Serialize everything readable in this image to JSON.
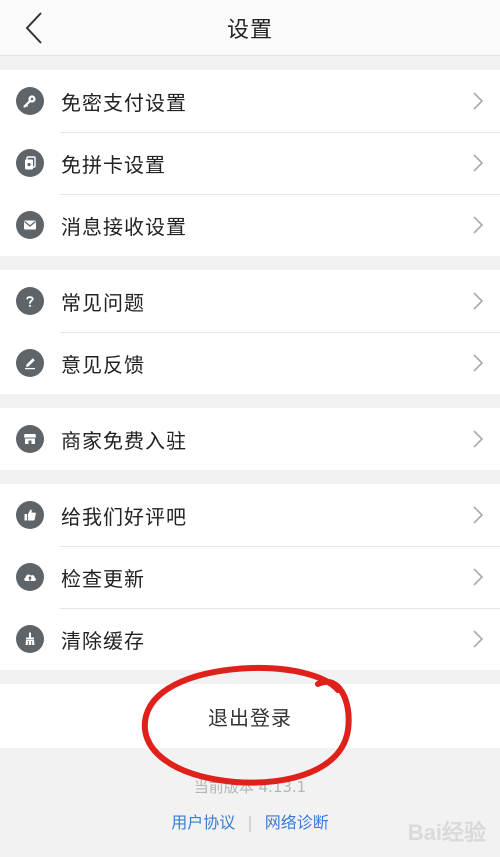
{
  "header": {
    "title": "设置"
  },
  "groups": [
    {
      "items": [
        {
          "label": "免密支付设置",
          "icon": "key-icon"
        },
        {
          "label": "免拼卡设置",
          "icon": "card-icon"
        },
        {
          "label": "消息接收设置",
          "icon": "mail-icon"
        }
      ]
    },
    {
      "items": [
        {
          "label": "常见问题",
          "icon": "question-icon"
        },
        {
          "label": "意见反馈",
          "icon": "pencil-icon"
        }
      ]
    },
    {
      "items": [
        {
          "label": "商家免费入驻",
          "icon": "store-icon"
        }
      ]
    },
    {
      "items": [
        {
          "label": "给我们好评吧",
          "icon": "thumbs-up-icon"
        },
        {
          "label": "检查更新",
          "icon": "cloud-upload-icon"
        },
        {
          "label": "清除缓存",
          "icon": "broom-icon"
        }
      ]
    }
  ],
  "logout": {
    "label": "退出登录"
  },
  "footer": {
    "version": "当前版本 4.13.1",
    "user_agreement": "用户协议",
    "separator": "|",
    "network_diagnosis": "网络诊断"
  },
  "watermark": "Bai经验",
  "colors": {
    "icon_bg": "#5f6468",
    "link": "#3b7bd6",
    "annotation_circle": "#e0201b"
  }
}
